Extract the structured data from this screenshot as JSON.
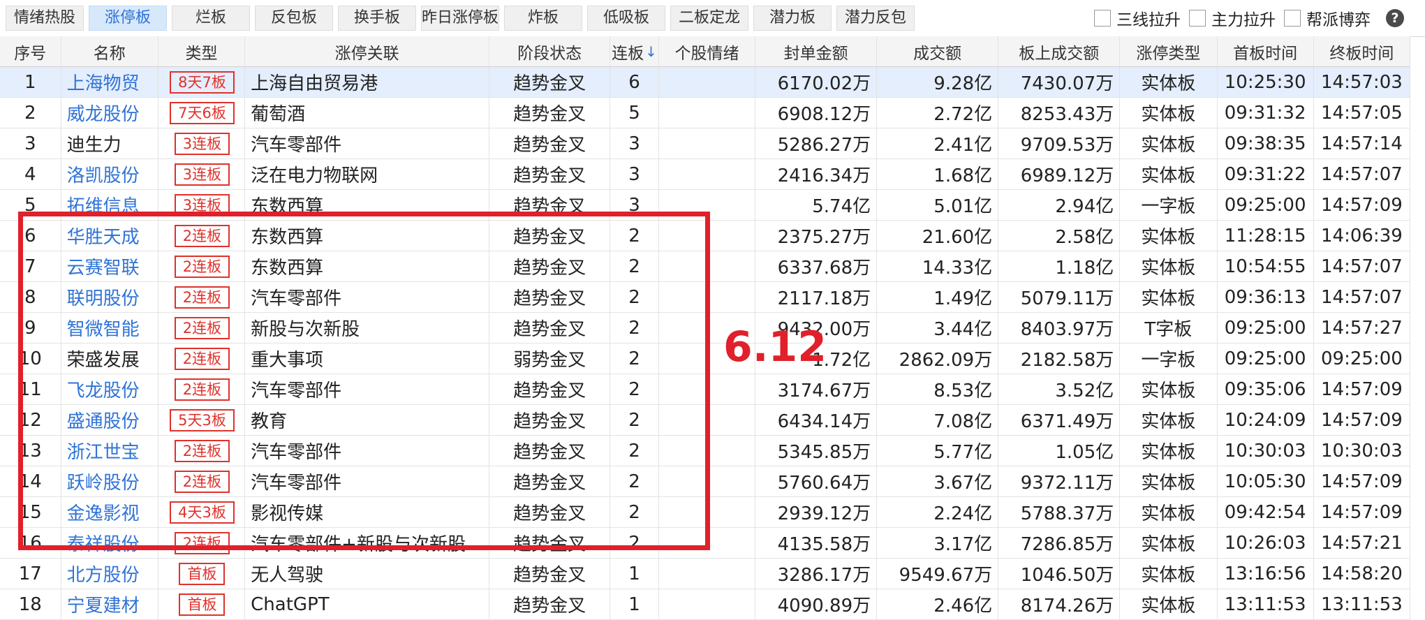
{
  "tabs": [
    {
      "label": "情绪热股",
      "active": false
    },
    {
      "label": "涨停板",
      "active": true
    },
    {
      "label": "烂板",
      "active": false
    },
    {
      "label": "反包板",
      "active": false
    },
    {
      "label": "换手板",
      "active": false
    },
    {
      "label": "昨日涨停板",
      "active": false
    },
    {
      "label": "炸板",
      "active": false
    },
    {
      "label": "低吸板",
      "active": false
    },
    {
      "label": "二板定龙",
      "active": false
    },
    {
      "label": "潜力板",
      "active": false
    },
    {
      "label": "潜力反包",
      "active": false
    }
  ],
  "filters": [
    {
      "label": "三线拉升",
      "checked": false
    },
    {
      "label": "主力拉升",
      "checked": false
    },
    {
      "label": "帮派博弈",
      "checked": false
    }
  ],
  "help_icon": "?",
  "columns": [
    "序号",
    "名称",
    "类型",
    "涨停关联",
    "阶段状态",
    "连板",
    "个股情绪",
    "封单金额",
    "成交额",
    "板上成交额",
    "涨停类型",
    "首板时间",
    "终板时间"
  ],
  "sort_indicator": "↓",
  "rows": [
    {
      "no": "1",
      "name": "上海物贸",
      "link": true,
      "type": "8天7板",
      "concept": "上海自由贸易港",
      "stage": "趋势金叉",
      "boards": "6",
      "mood": "",
      "seal": "6170.02万",
      "turnover": "9.28亿",
      "board_turnover": "7430.07万",
      "limit_type": "实体板",
      "first_time": "10:25:30",
      "last_time": "14:57:03"
    },
    {
      "no": "2",
      "name": "威龙股份",
      "link": true,
      "type": "7天6板",
      "concept": "葡萄酒",
      "stage": "趋势金叉",
      "boards": "5",
      "mood": "",
      "seal": "6908.12万",
      "turnover": "2.72亿",
      "board_turnover": "8253.43万",
      "limit_type": "实体板",
      "first_time": "09:31:32",
      "last_time": "14:57:05"
    },
    {
      "no": "3",
      "name": "迪生力",
      "link": false,
      "type": "3连板",
      "concept": "汽车零部件",
      "stage": "趋势金叉",
      "boards": "3",
      "mood": "",
      "seal": "5286.27万",
      "turnover": "2.41亿",
      "board_turnover": "9709.53万",
      "limit_type": "实体板",
      "first_time": "09:38:35",
      "last_time": "14:57:14"
    },
    {
      "no": "4",
      "name": "洛凯股份",
      "link": true,
      "type": "3连板",
      "concept": "泛在电力物联网",
      "stage": "趋势金叉",
      "boards": "3",
      "mood": "",
      "seal": "2416.34万",
      "turnover": "1.68亿",
      "board_turnover": "6989.12万",
      "limit_type": "实体板",
      "first_time": "09:31:22",
      "last_time": "14:57:07"
    },
    {
      "no": "5",
      "name": "拓维信息",
      "link": true,
      "type": "3连板",
      "concept": "东数西算",
      "stage": "趋势金叉",
      "boards": "3",
      "mood": "",
      "seal": "5.74亿",
      "turnover": "5.01亿",
      "board_turnover": "2.94亿",
      "limit_type": "一字板",
      "first_time": "09:25:00",
      "last_time": "14:57:09"
    },
    {
      "no": "6",
      "name": "华胜天成",
      "link": true,
      "type": "2连板",
      "concept": "东数西算",
      "stage": "趋势金叉",
      "boards": "2",
      "mood": "",
      "seal": "2375.27万",
      "turnover": "21.60亿",
      "board_turnover": "2.58亿",
      "limit_type": "实体板",
      "first_time": "11:28:15",
      "last_time": "14:06:39"
    },
    {
      "no": "7",
      "name": "云赛智联",
      "link": true,
      "type": "2连板",
      "concept": "东数西算",
      "stage": "趋势金叉",
      "boards": "2",
      "mood": "",
      "seal": "6337.68万",
      "turnover": "14.33亿",
      "board_turnover": "1.18亿",
      "limit_type": "实体板",
      "first_time": "10:54:55",
      "last_time": "14:57:07"
    },
    {
      "no": "8",
      "name": "联明股份",
      "link": true,
      "type": "2连板",
      "concept": "汽车零部件",
      "stage": "趋势金叉",
      "boards": "2",
      "mood": "",
      "seal": "2117.18万",
      "turnover": "1.49亿",
      "board_turnover": "5079.11万",
      "limit_type": "实体板",
      "first_time": "09:36:13",
      "last_time": "14:57:07"
    },
    {
      "no": "9",
      "name": "智微智能",
      "link": true,
      "type": "2连板",
      "concept": "新股与次新股",
      "stage": "趋势金叉",
      "boards": "2",
      "mood": "",
      "seal": "9432.00万",
      "turnover": "3.44亿",
      "board_turnover": "8403.97万",
      "limit_type": "T字板",
      "first_time": "09:25:00",
      "last_time": "14:57:27"
    },
    {
      "no": "10",
      "name": "荣盛发展",
      "link": false,
      "type": "2连板",
      "concept": "重大事项",
      "stage": "弱势金叉",
      "boards": "2",
      "mood": "",
      "seal": "1.72亿",
      "turnover": "2862.09万",
      "board_turnover": "2182.58万",
      "limit_type": "一字板",
      "first_time": "09:25:00",
      "last_time": "09:25:00"
    },
    {
      "no": "11",
      "name": "飞龙股份",
      "link": true,
      "type": "2连板",
      "concept": "汽车零部件",
      "stage": "趋势金叉",
      "boards": "2",
      "mood": "",
      "seal": "3174.67万",
      "turnover": "8.53亿",
      "board_turnover": "3.52亿",
      "limit_type": "实体板",
      "first_time": "09:35:06",
      "last_time": "14:57:09"
    },
    {
      "no": "12",
      "name": "盛通股份",
      "link": true,
      "type": "5天3板",
      "concept": "教育",
      "stage": "趋势金叉",
      "boards": "2",
      "mood": "",
      "seal": "6434.14万",
      "turnover": "7.08亿",
      "board_turnover": "6371.49万",
      "limit_type": "实体板",
      "first_time": "10:24:09",
      "last_time": "14:57:09"
    },
    {
      "no": "13",
      "name": "浙江世宝",
      "link": true,
      "type": "2连板",
      "concept": "汽车零部件",
      "stage": "趋势金叉",
      "boards": "2",
      "mood": "",
      "seal": "5345.85万",
      "turnover": "5.77亿",
      "board_turnover": "1.05亿",
      "limit_type": "实体板",
      "first_time": "10:30:03",
      "last_time": "10:30:03"
    },
    {
      "no": "14",
      "name": "跃岭股份",
      "link": true,
      "type": "2连板",
      "concept": "汽车零部件",
      "stage": "趋势金叉",
      "boards": "2",
      "mood": "",
      "seal": "5760.64万",
      "turnover": "3.67亿",
      "board_turnover": "9372.11万",
      "limit_type": "实体板",
      "first_time": "10:05:30",
      "last_time": "14:57:09"
    },
    {
      "no": "15",
      "name": "金逸影视",
      "link": true,
      "type": "4天3板",
      "concept": "影视传媒",
      "stage": "趋势金叉",
      "boards": "2",
      "mood": "",
      "seal": "2939.12万",
      "turnover": "2.24亿",
      "board_turnover": "5788.37万",
      "limit_type": "实体板",
      "first_time": "09:42:54",
      "last_time": "14:57:09"
    },
    {
      "no": "16",
      "name": "泰祥股份",
      "link": true,
      "type": "2连板",
      "concept": "汽车零部件+新股与次新股",
      "stage": "趋势金叉",
      "boards": "2",
      "mood": "",
      "seal": "4135.58万",
      "turnover": "3.17亿",
      "board_turnover": "7286.85万",
      "limit_type": "实体板",
      "first_time": "10:26:03",
      "last_time": "14:57:21"
    },
    {
      "no": "17",
      "name": "北方股份",
      "link": true,
      "type": "首板",
      "concept": "无人驾驶",
      "stage": "趋势金叉",
      "boards": "1",
      "mood": "",
      "seal": "3286.17万",
      "turnover": "9549.67万",
      "board_turnover": "1046.50万",
      "limit_type": "实体板",
      "first_time": "13:16:56",
      "last_time": "14:58:20"
    },
    {
      "no": "18",
      "name": "宁夏建材",
      "link": true,
      "type": "首板",
      "concept": "ChatGPT",
      "stage": "趋势金叉",
      "boards": "1",
      "mood": "",
      "seal": "4090.89万",
      "turnover": "2.46亿",
      "board_turnover": "8174.26万",
      "limit_type": "实体板",
      "first_time": "13:11:53",
      "last_time": "13:11:53"
    }
  ],
  "annotation": {
    "text": "6.12",
    "color": "#e0202a"
  },
  "colors": {
    "link": "#2f73d6",
    "badge": "#e0312b",
    "selected_row": "#e4eefc",
    "active_tab": "#d7e8fb"
  }
}
